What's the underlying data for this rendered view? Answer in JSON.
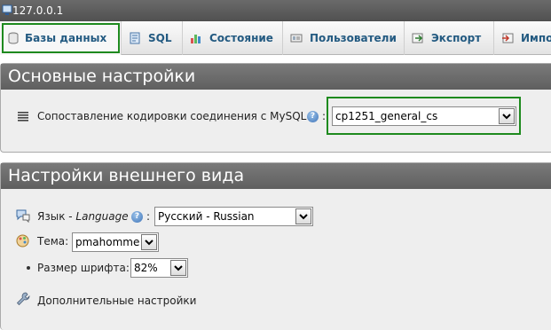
{
  "server": {
    "title": "127.0.0.1",
    "icon": "server-icon"
  },
  "tabs": [
    {
      "label": "Базы данных",
      "icon": "database-icon",
      "active": true
    },
    {
      "label": "SQL",
      "icon": "sql-icon"
    },
    {
      "label": "Состояние",
      "icon": "status-icon"
    },
    {
      "label": "Пользователи",
      "icon": "users-icon"
    },
    {
      "label": "Экспорт",
      "icon": "export-icon"
    },
    {
      "label": "Импо",
      "icon": "import-icon"
    }
  ],
  "general": {
    "heading": "Основные настройки",
    "collation_label": "Сопоставление кодировки соединения с MySQL",
    "collation_value": "cp1251_general_cs",
    "colon": ":"
  },
  "appearance": {
    "heading": "Настройки внешнего вида",
    "language_label_prefix": "Язык - ",
    "language_label_italic": "Language",
    "language_value": "Русский - Russian",
    "theme_label": "Тема:",
    "theme_value": "pmahomme",
    "fontsize_label": "Размер шрифта:",
    "fontsize_value": "82%",
    "more_settings": "Дополнительные настройки",
    "colon": ":"
  },
  "colors": {
    "accent": "#235a81",
    "highlight": "#1e8a1e",
    "header": "#666666"
  }
}
